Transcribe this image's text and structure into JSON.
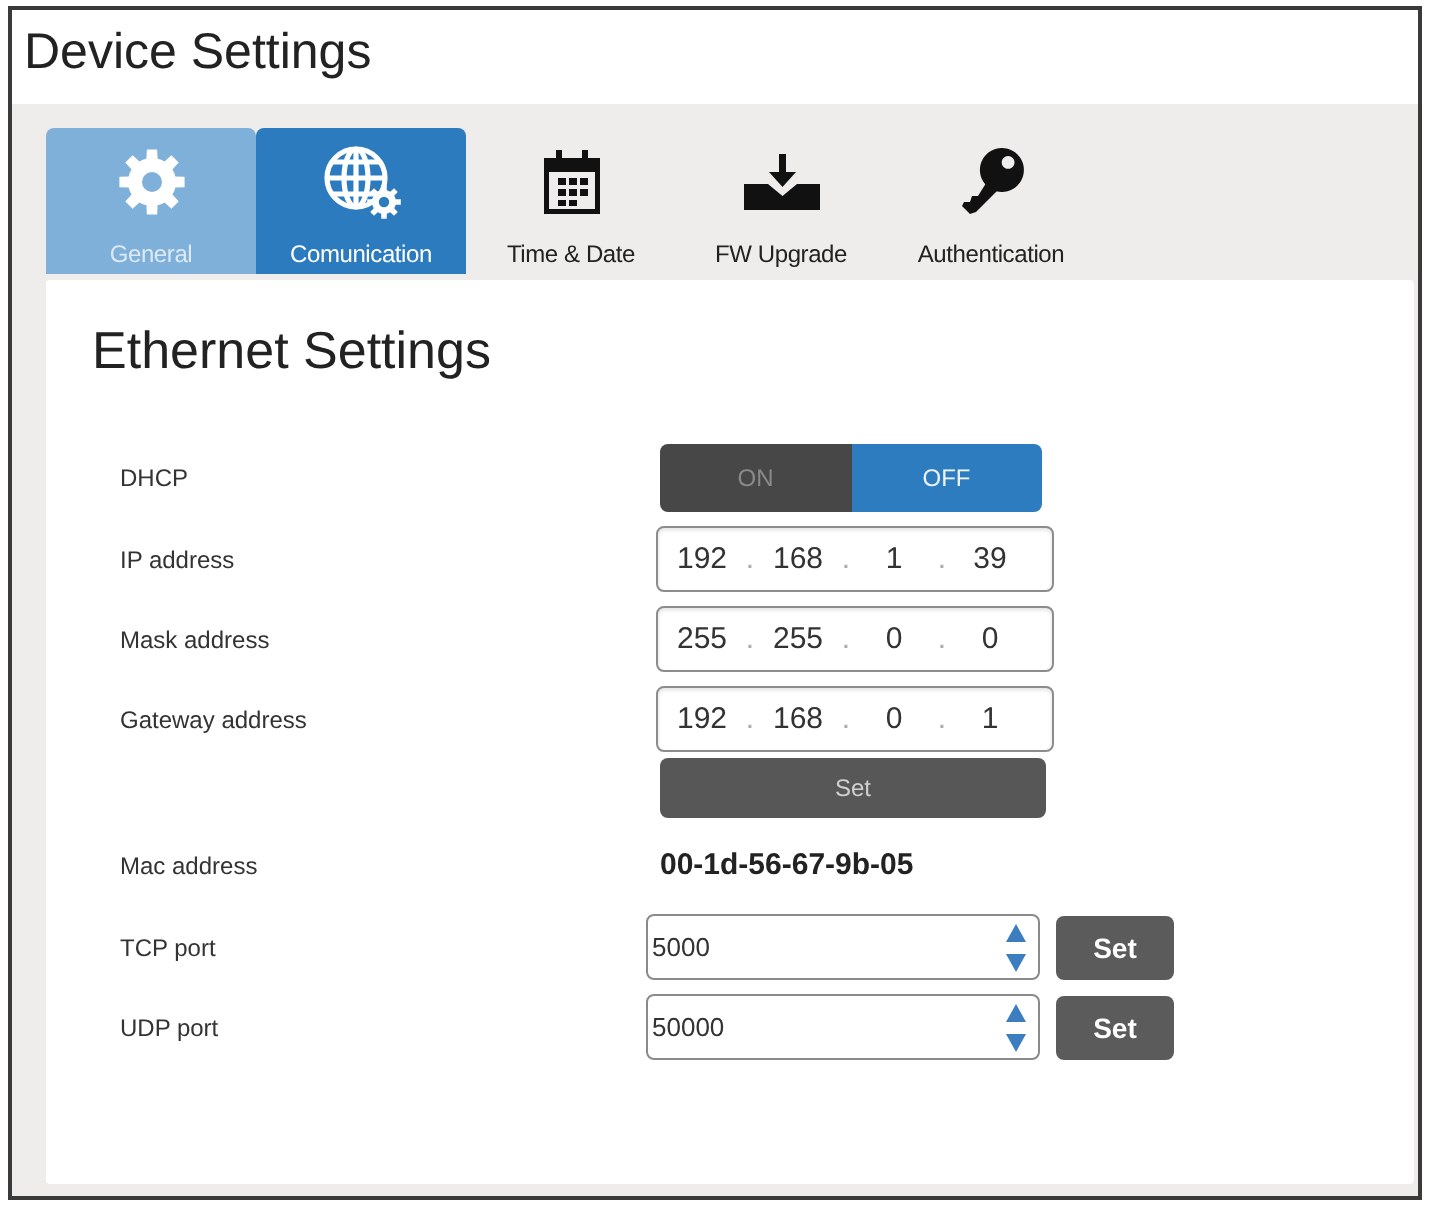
{
  "window": {
    "title": "Device Settings"
  },
  "tabs": [
    {
      "label": "General",
      "selected": false,
      "highlighted": true
    },
    {
      "label": "Comunication",
      "selected": true,
      "highlighted": false
    },
    {
      "label": "Time & Date",
      "selected": false,
      "highlighted": false
    },
    {
      "label": "FW Upgrade",
      "selected": false,
      "highlighted": false
    },
    {
      "label": "Authentication",
      "selected": false,
      "highlighted": false
    }
  ],
  "section": {
    "title": "Ethernet Settings",
    "rows": [
      {
        "kind": "toggle",
        "label": "DHCP",
        "options": [
          {
            "label": "ON",
            "selected": false
          },
          {
            "label": "OFF",
            "selected": true
          }
        ]
      },
      {
        "kind": "ip",
        "label": "IP address",
        "octets": [
          "192",
          "168",
          "1",
          "39"
        ],
        "separator": "."
      },
      {
        "kind": "ip",
        "label": "Mask address",
        "octets": [
          "255",
          "255",
          "0",
          "0"
        ],
        "separator": "."
      },
      {
        "kind": "ip",
        "label": "Gateway address",
        "octets": [
          "192",
          "168",
          "0",
          "1"
        ],
        "separator": "."
      },
      {
        "kind": "button",
        "button": "Set"
      },
      {
        "kind": "text",
        "label": "Mac address",
        "value": "00-1d-56-67-9b-05"
      },
      {
        "kind": "port",
        "label": "TCP port",
        "value": "5000",
        "button": "Set"
      },
      {
        "kind": "port",
        "label": "UDP port",
        "value": "50000",
        "button": "Set"
      }
    ]
  }
}
